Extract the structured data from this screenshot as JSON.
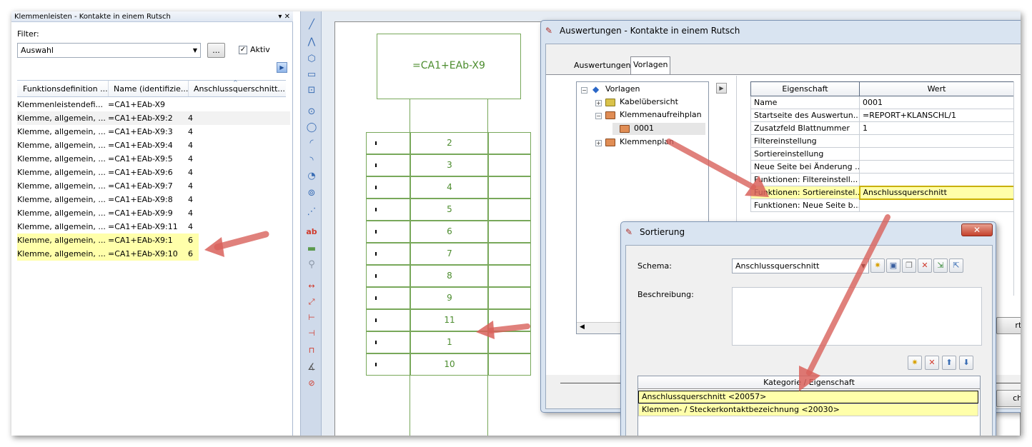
{
  "left_panel": {
    "title": "Klemmenleisten - Kontakte in einem Rutsch",
    "title_controls": "▾ ✕",
    "filter_label": "Filter:",
    "filter_value": "Auswahl",
    "ellipsis_label": "...",
    "aktiv_label": "Aktiv",
    "aktiv_checked": "✓",
    "columns": [
      "Funktionsdefinition ...",
      "Name (identifizie...",
      "Anschlussquerschnitt..."
    ],
    "rows": [
      {
        "def": "Klemmenleistendefi...",
        "name": "=CA1+EAb-X9",
        "q": ""
      },
      {
        "def": "Klemme, allgemein, ...",
        "name": "=CA1+EAb-X9:2",
        "q": "4"
      },
      {
        "def": "Klemme, allgemein, ...",
        "name": "=CA1+EAb-X9:3",
        "q": "4"
      },
      {
        "def": "Klemme, allgemein, ...",
        "name": "=CA1+EAb-X9:4",
        "q": "4"
      },
      {
        "def": "Klemme, allgemein, ...",
        "name": "=CA1+EAb-X9:5",
        "q": "4"
      },
      {
        "def": "Klemme, allgemein, ...",
        "name": "=CA1+EAb-X9:6",
        "q": "4"
      },
      {
        "def": "Klemme, allgemein, ...",
        "name": "=CA1+EAb-X9:7",
        "q": "4"
      },
      {
        "def": "Klemme, allgemein, ...",
        "name": "=CA1+EAb-X9:8",
        "q": "4"
      },
      {
        "def": "Klemme, allgemein, ...",
        "name": "=CA1+EAb-X9:9",
        "q": "4"
      },
      {
        "def": "Klemme, allgemein, ...",
        "name": "=CA1+EAb-X9:11",
        "q": "4"
      },
      {
        "def": "Klemme, allgemein, ...",
        "name": "=CA1+EAb-X9:1",
        "q": "6"
      },
      {
        "def": "Klemme, allgemein, ...",
        "name": "=CA1+EAb-X9:10",
        "q": "6"
      }
    ]
  },
  "drawing": {
    "strip_label": "=CA1+EAb-X9",
    "terminals": [
      "2",
      "3",
      "4",
      "5",
      "6",
      "7",
      "8",
      "9",
      "11",
      "1",
      "10"
    ]
  },
  "auswertungen": {
    "title": "Auswertungen - Kontakte in einem Rutsch",
    "tabs": [
      "Auswertungen",
      "Vorlagen"
    ],
    "tree": {
      "root": "Vorlagen",
      "items": [
        "Kabelübersicht",
        "Klemmenaufreihplan",
        "0001",
        "Klemmenplan"
      ]
    },
    "prop_headers": [
      "Eigenschaft",
      "Wert"
    ],
    "props": [
      {
        "name": "Name",
        "value": "0001"
      },
      {
        "name": "Startseite des Auswertun...",
        "value": "=REPORT+KLANSCHL/1"
      },
      {
        "name": "Zusatzfeld Blattnummer",
        "value": "1"
      },
      {
        "name": "Filtereinstellung",
        "value": ""
      },
      {
        "name": "Sortiereinstellung",
        "value": ""
      },
      {
        "name": "Neue Seite bei Änderung ...",
        "value": ""
      },
      {
        "name": "Funktionen: Filtereinstell...",
        "value": ""
      },
      {
        "name": "Funktionen: Sortiereinstel...",
        "value": "Anschlussquerschnitt"
      },
      {
        "name": "Funktionen: Neue Seite b...",
        "value": ""
      }
    ],
    "partial_button_1": "rten",
    "partial_button_2": "chlie"
  },
  "sortierung": {
    "title": "Sortierung",
    "close_label": "✕",
    "schema_label": "Schema:",
    "schema_value": "Anschlussquerschnitt",
    "beschreibung_label": "Beschreibung:",
    "list_header": "Kategorie / Eigenschaft",
    "list_items": [
      "Anschlussquerschnitt <20057>",
      "Klemmen- / Steckerkontaktbezeichnung <20030>"
    ]
  },
  "colors": {
    "highlight": "#ffffaa",
    "drawing_green": "#4c8c2e",
    "arrow": "#e07b78"
  }
}
